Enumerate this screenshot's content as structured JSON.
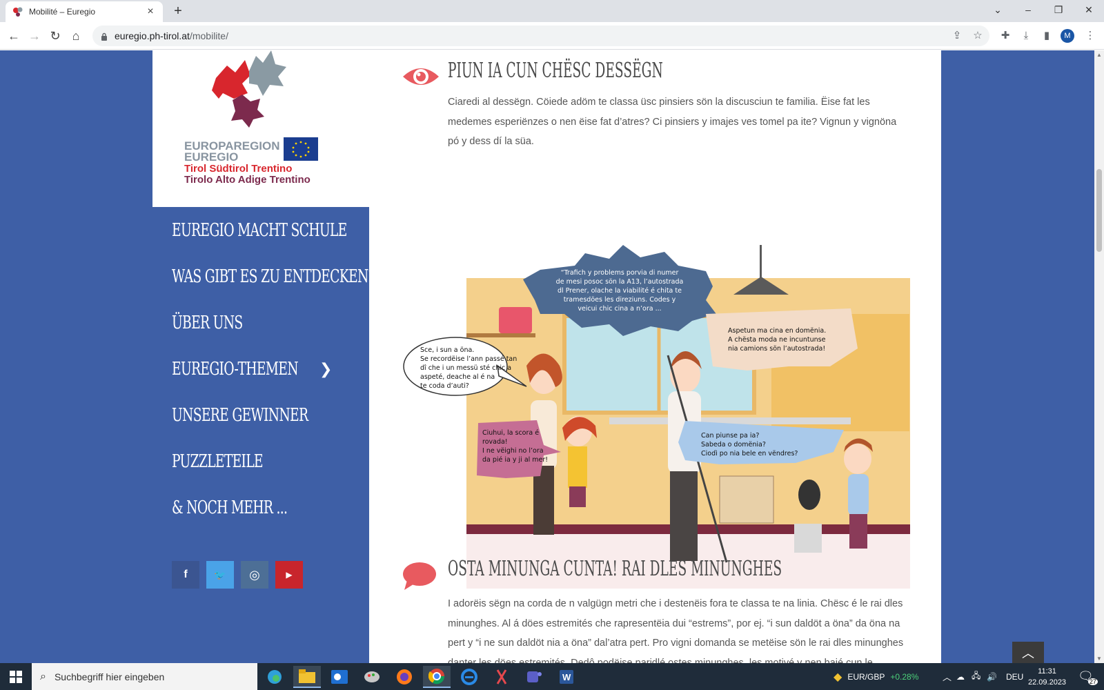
{
  "browser": {
    "tab_title": "Mobilité – Euregio",
    "url_host": "euregio.ph-tirol.at",
    "url_path": "/mobilite/",
    "profile_initial": "M"
  },
  "logo": {
    "line1": "EUROPAREGION",
    "line2": "EUREGIO",
    "line3": "Tirol Südtirol Trentino",
    "line4": "Tirolo Alto Adige Trentino"
  },
  "nav": {
    "items": [
      {
        "label": "EUREGIO MACHT SCHULE"
      },
      {
        "label": "WAS GIBT ES ZU ENTDECKEN?"
      },
      {
        "label": "ÜBER UNS"
      },
      {
        "label": "EUREGIO-THEMEN"
      },
      {
        "label": "UNSERE GEWINNER"
      },
      {
        "label": "PUZZLETEILE"
      },
      {
        "label": "& NOCH MEHR ..."
      }
    ]
  },
  "social": {
    "facebook": "f",
    "twitter": "🐦",
    "instagram": "◎",
    "youtube": "▶"
  },
  "section1": {
    "heading": "PIUN IA CUN CHËSC DESSËGN",
    "text": "Ciaredi al dessëgn. Cöiede adöm te classa üsc pinsiers sön la discusciun te familia. Ëise fat les medemes esperiënzes o nen ëise fat d’atres? Ci pinsiers y imajes ves tomel pa ite? Vignun y vignöna pó y dess dí la süa."
  },
  "illustration": {
    "bubble_top": [
      "“Trafich y problems porvia di numer",
      "de mesi posoc sön la A13, l’autostrada",
      "dl Prener, olache la viabilité é chita te",
      "tramesdöes les direziuns. Codes y",
      "veicui chic cina a n’ora ..."
    ],
    "bubble_right": [
      "Aspetun ma cina en domënia.",
      "A chësta moda ne incuntunse",
      "nia camions sön l’autostrada!"
    ],
    "bubble_left": [
      "Sce, i sun a öna.",
      "Se recordëise l’ann passé tan",
      "dî che i un messü sté chic a",
      "aspeté, deache al é na",
      "te coda d’auti?"
    ],
    "bubble_girl": [
      "Ciuhui, la scora é",
      "rovada!",
      "I ne vëighi no l’ora",
      "da pié ia y ji al mer!"
    ],
    "bubble_boy": [
      "Can piunse pa ia?",
      "Sabeda o domënia?",
      "Ciodì po nia bele en vëndres?"
    ]
  },
  "section2": {
    "heading": "OSTA MINUNGA CUNTA! RAI DLES MINUNGHES",
    "text": "I adorëis sëgn na corda de n valgügn metri che i destenëis fora te classa te na linia. Chësc é le rai dles minunghes. Al á döes estremités che rapresentëia dui “estrems”, por ej. “i sun daldöt a öna” da öna na pert y “i ne sun daldöt nia a öna” dal’atra pert. Pro vigni domanda se metëise sön le rai dles minunghes danter les döes estremités. Dedô podëise paridlé ostes minunghes, les motivé y nen baié cun le"
  },
  "taskbar": {
    "search_placeholder": "Suchbegriff hier eingeben",
    "ticker_pair": "EUR/GBP",
    "ticker_change": "+0.28%",
    "language": "DEU",
    "time": "11:31",
    "date": "22.09.2023",
    "notifications": "27"
  }
}
